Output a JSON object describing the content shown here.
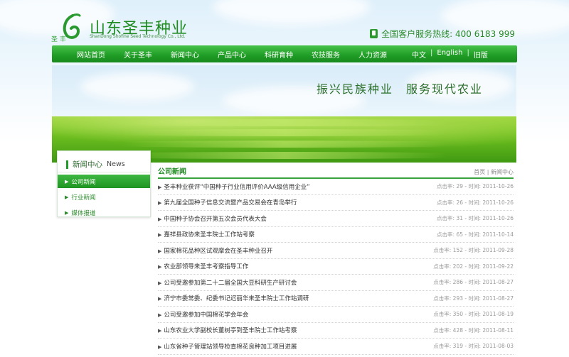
{
  "header": {
    "logo_title": "山东圣丰种业",
    "logo_sub": "ShanDong Shofine Seed Technology Co., Ltd.",
    "logo_mark_text": "圣 丰",
    "hotline": "全国客户服务热线: 400 6183 999"
  },
  "nav": {
    "items": [
      "网站首页",
      "关于圣丰",
      "新闻中心",
      "产品中心",
      "科研育种",
      "农技服务",
      "人力资源"
    ],
    "lang": [
      "中文",
      "English",
      "旧版"
    ]
  },
  "banner": {
    "slogan": "振兴民族种业　服务现代农业"
  },
  "sidebar": {
    "title": "新闻中心",
    "title_en": "News",
    "items": [
      "公司新闻",
      "行业新闻",
      "媒体报道"
    ]
  },
  "content": {
    "title": "公司新闻",
    "breadcrumb": "首页 | 新闻中心",
    "clicks_label": "点击率:",
    "time_label": "时间:",
    "news": [
      {
        "title": "圣丰种业获评“中国种子行业信用评价AAA级信用企业”",
        "clicks": "29",
        "date": "2011-10-26"
      },
      {
        "title": "第九届全国种子信息交流暨产品交易会在青岛举行",
        "clicks": "26",
        "date": "2011-10-26"
      },
      {
        "title": "中国种子协会召开第五次会员代表大会",
        "clicks": "31",
        "date": "2011-10-26"
      },
      {
        "title": "嘉祥县政协来圣丰院士工作站考察",
        "clicks": "65",
        "date": "2011-10-14"
      },
      {
        "title": "国家棉花品种区试观摩会在圣丰种业召开",
        "clicks": "152",
        "date": "2011-09-28"
      },
      {
        "title": "农业部领导来圣丰考察指导工作",
        "clicks": "202",
        "date": "2011-09-22"
      },
      {
        "title": "公司受邀参加第二十二届全国大豆科研生产研讨会",
        "clicks": "286",
        "date": "2011-08-27"
      },
      {
        "title": "济宁市委常委、纪委书记迟丽华来圣丰院士工作站调研",
        "clicks": "293",
        "date": "2011-08-27"
      },
      {
        "title": "公司受邀参加中国棉花学会年会",
        "clicks": "350",
        "date": "2011-08-19"
      },
      {
        "title": "山东农业大学副校长董树亭到圣丰院士工作站考察",
        "clicks": "428",
        "date": "2011-08-11"
      },
      {
        "title": "山东省种子管理站领导检查棉花良种加工项目进展",
        "clicks": "319",
        "date": "2011-08-03"
      }
    ]
  }
}
